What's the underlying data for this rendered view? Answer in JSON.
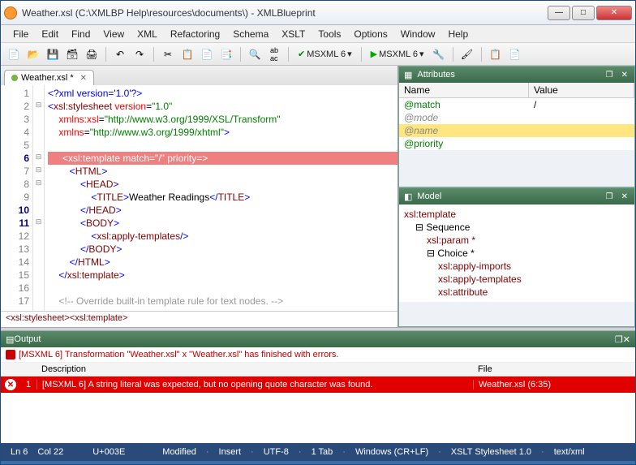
{
  "window": {
    "title": "Weather.xsl  (C:\\XMLBP Help\\resources\\documents\\) - XMLBlueprint"
  },
  "menu": [
    "File",
    "Edit",
    "Find",
    "View",
    "XML",
    "Refactoring",
    "Schema",
    "XSLT",
    "Tools",
    "Options",
    "Window",
    "Help"
  ],
  "toolbar": {
    "msxml_check": "MSXML 6",
    "msxml_run": "MSXML 6"
  },
  "tab": {
    "label": "Weather.xsl *"
  },
  "code": {
    "lines": [
      {
        "n": 1,
        "fold": "",
        "html": "<span class='c-pi'>&lt;?xml version='1.0'?&gt;</span>"
      },
      {
        "n": 2,
        "fold": "⊟",
        "html": "<span class='c-tagb'>&lt;</span><span class='c-tag'>xsl:stylesheet</span> <span class='c-attr'>version</span>=<span class='c-str'>\"1.0\"</span>"
      },
      {
        "n": 3,
        "fold": "",
        "html": "    <span class='c-attr'>xmlns:xsl</span>=<span class='c-str'>\"http://www.w3.org/1999/XSL/Transform\"</span>"
      },
      {
        "n": 4,
        "fold": "",
        "html": "    <span class='c-attr'>xmlns</span>=<span class='c-str'>\"http://www.w3.org/1999/xhtml\"</span><span class='c-tagb'>&gt;</span>"
      },
      {
        "n": 5,
        "fold": "",
        "html": ""
      },
      {
        "n": 6,
        "fold": "⊟",
        "hl": true,
        "html": "&lt;xsl:template match=\"/\" priority=&gt;"
      },
      {
        "n": 7,
        "fold": "⊟",
        "html": "        <span class='c-tagb'>&lt;</span><span class='c-tag'>HTML</span><span class='c-tagb'>&gt;</span>"
      },
      {
        "n": 8,
        "fold": "⊟",
        "html": "            <span class='c-tagb'>&lt;</span><span class='c-tag'>HEAD</span><span class='c-tagb'>&gt;</span>"
      },
      {
        "n": 9,
        "fold": "",
        "html": "                <span class='c-tagb'>&lt;</span><span class='c-tag'>TITLE</span><span class='c-tagb'>&gt;</span><span class='c-txt'>Weather Readings</span><span class='c-tagb'>&lt;/</span><span class='c-tag'>TITLE</span><span class='c-tagb'>&gt;</span>"
      },
      {
        "n": 10,
        "fold": "",
        "html": "            <span class='c-tagb'>&lt;/</span><span class='c-tag'>HEAD</span><span class='c-tagb'>&gt;</span>"
      },
      {
        "n": 11,
        "fold": "⊟",
        "html": "            <span class='c-tagb'>&lt;</span><span class='c-tag'>BODY</span><span class='c-tagb'>&gt;</span>"
      },
      {
        "n": 12,
        "fold": "",
        "html": "                <span class='c-tagb'>&lt;</span><span class='c-tag'>xsl:apply-templates</span><span class='c-tagb'>/&gt;</span>"
      },
      {
        "n": 13,
        "fold": "",
        "html": "            <span class='c-tagb'>&lt;/</span><span class='c-tag'>BODY</span><span class='c-tagb'>&gt;</span>"
      },
      {
        "n": 14,
        "fold": "",
        "html": "        <span class='c-tagb'>&lt;/</span><span class='c-tag'>HTML</span><span class='c-tagb'>&gt;</span>"
      },
      {
        "n": 15,
        "fold": "",
        "html": "    <span class='c-tagb'>&lt;/</span><span class='c-tag'>xsl:template</span><span class='c-tagb'>&gt;</span>"
      },
      {
        "n": 16,
        "fold": "",
        "html": ""
      },
      {
        "n": 17,
        "fold": "",
        "html": "    <span class='c-cmt'>&lt;!-- Override built-in template rule for text nodes. --&gt;</span>"
      }
    ]
  },
  "breadcrumb": "<xsl:stylesheet><xsl:template>",
  "attributes": {
    "title": "Attributes",
    "headers": {
      "name": "Name",
      "value": "Value"
    },
    "rows": [
      {
        "name": "@match",
        "value": "/",
        "set": true
      },
      {
        "name": "@mode",
        "value": ""
      },
      {
        "name": "@name",
        "value": "",
        "sel": true
      },
      {
        "name": "@priority",
        "value": "",
        "set": true
      }
    ]
  },
  "model": {
    "title": "Model",
    "items": [
      {
        "t": "xsl:template",
        "cls": "n",
        "ind": 0
      },
      {
        "t": "⊟ Sequence",
        "ind": 1
      },
      {
        "t": "xsl:param *",
        "cls": "n",
        "ind": 2,
        "pre": ""
      },
      {
        "t": "⊟ Choice *",
        "ind": 2
      },
      {
        "t": "xsl:apply-imports",
        "cls": "n",
        "ind": 3
      },
      {
        "t": "xsl:apply-templates",
        "cls": "n",
        "ind": 3
      },
      {
        "t": "xsl:attribute",
        "cls": "n",
        "ind": 3
      }
    ]
  },
  "output": {
    "title": "Output",
    "summary": "[MSXML 6] Transformation \"Weather.xsl\" x \"Weather.xsl\" has finished with errors.",
    "headers": {
      "desc": "Description",
      "file": "File"
    },
    "row": {
      "num": "1",
      "desc": "[MSXML 6] A string literal was expected, but no opening quote character was found.",
      "file": "Weather.xsl (6:35)"
    }
  },
  "status": {
    "ln": "Ln 6",
    "col": "Col 22",
    "codepoint": "U+003E",
    "items": [
      "Modified",
      "Insert",
      "UTF-8",
      "1 Tab",
      "Windows (CR+LF)",
      "XSLT Stylesheet 1.0",
      "text/xml"
    ]
  }
}
